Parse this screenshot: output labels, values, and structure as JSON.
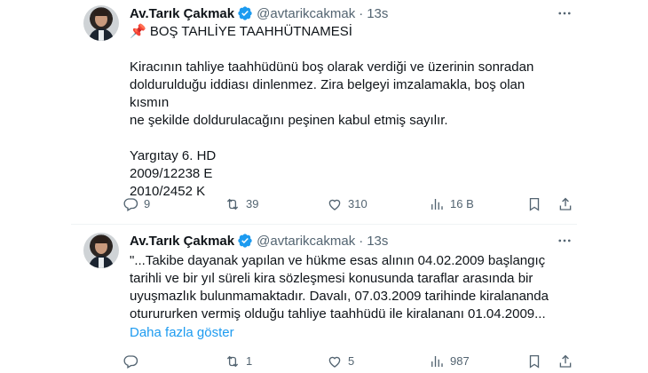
{
  "tweets": [
    {
      "author": {
        "name": "Av.Tarık Çakmak",
        "handle": "@avtarikcakmak",
        "time": "13s",
        "avatar": "avatar-photo"
      },
      "title_emoji": "📌",
      "title": "BOŞ TAHLİYE TAAHHÜTNAMESİ",
      "paragraphs": [
        "Kiracının tahliye taahhüdünü boş olarak verdiği ve üzerinin sonradan",
        "doldurulduğu iddiası dinlenmez. Zira belgeyi imzalamakla, boş olan kısmın",
        "ne şekilde doldurulacağını peşinen kabul etmiş sayılır."
      ],
      "citation": [
        "Yargıtay 6. HD",
        "2009/12238 E",
        "2010/2452 K"
      ],
      "stats": {
        "replies": "9",
        "retweets": "39",
        "likes": "310",
        "views": "16 B"
      }
    },
    {
      "author": {
        "name": "Av.Tarık Çakmak",
        "handle": "@avtarikcakmak",
        "time": "13s",
        "avatar": "avatar-photo"
      },
      "lines": [
        "\"...Takibe dayanak yapılan ve hükme esas alının 04.02.2009 başlangıç",
        "tarihli ve bir yıl süreli kira sözleşmesi konusunda taraflar arasında bir",
        "uyuşmazlık bulunmamaktadır. Davalı, 07.03.2009 tarihinde kiralananda",
        "oturururken vermiş olduğu tahliye taahhüdü ile kiralananı 01.04.2009..."
      ],
      "show_more": "Daha fazla göster",
      "stats": {
        "replies": "",
        "retweets": "1",
        "likes": "5",
        "views": "987"
      }
    }
  ],
  "icons": {
    "verified": "verified-badge-icon",
    "more": "more-dots-icon",
    "reply": "reply-icon",
    "retweet": "retweet-icon",
    "like": "heart-icon",
    "views": "views-chart-icon",
    "bookmark": "bookmark-icon",
    "share": "share-icon"
  },
  "colors": {
    "accent": "#1d9bf0",
    "muted": "#536471",
    "text": "#0f1419"
  }
}
